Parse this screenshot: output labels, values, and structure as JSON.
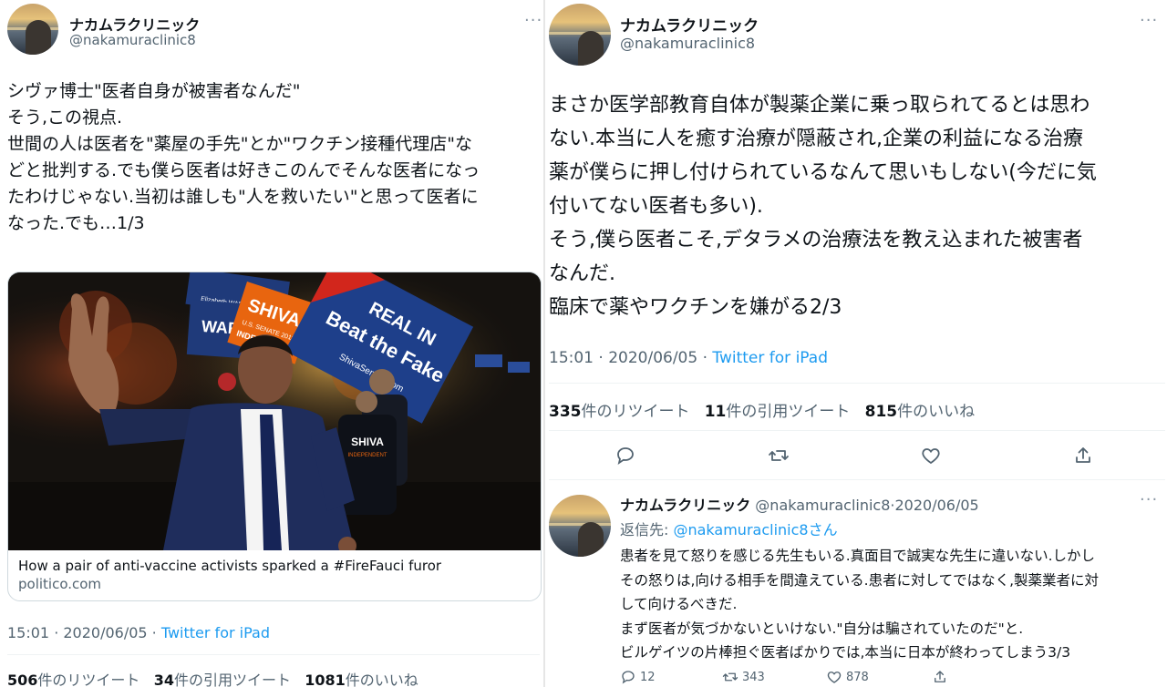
{
  "left": {
    "author": {
      "name": "ナカムラクリニック",
      "handle": "@nakamuraclinic8"
    },
    "more_label": "···",
    "text": "シヴァ博士\"医者自身が被害者なんだ\"\nそう,この視点.\n世間の人は医者を\"薬屋の手先\"とか\"ワクチン接種代理店\"な\nどと批判する.でも僕ら医者は好きこのんでそんな医者になっ\nたわけじゃない.当初は誰しも\"人を救いたい\"と思って医者に\nなった.でも…1/3",
    "card": {
      "title": "How a pair of anti-vaccine activists sparked a #FireFauci furor",
      "domain": "politico.com",
      "signs": [
        "SHIVA",
        "U.S. SENATE 2018",
        "INDEPENDENT",
        "Elizabeth WARREN FOR",
        "SHIVA",
        "INDEPENDENT",
        "REAL IN",
        "Beat the Fake",
        "ShivaSenate.com"
      ]
    },
    "time": "15:01 · 2020/06/05 · ",
    "source": "Twitter for iPad",
    "stats": {
      "retweets": "506",
      "retweets_label": "件のリツイート",
      "quotes": "34",
      "quotes_label": "件の引用ツイート",
      "likes": "1081",
      "likes_label": "件のいいね"
    }
  },
  "right": {
    "author": {
      "name": "ナカムラクリニック",
      "handle": "@nakamuraclinic8"
    },
    "more_label": "···",
    "text": "まさか医学部教育自体が製薬企業に乗っ取られてるとは思わ\nない.本当に人を癒す治療が隠蔽され,企業の利益になる治療\n薬が僕らに押し付けられているなんて思いもしない(今だに気\n付いてない医者も多い).\nそう,僕ら医者こそ,デタラメの治療法を教え込まれた被害者\nなんだ.\n臨床で薬やワクチンを嫌がる2/3",
    "time": "15:01 · 2020/06/05 · ",
    "source": "Twitter for iPad",
    "stats": {
      "retweets": "335",
      "retweets_label": "件のリツイート",
      "quotes": "11",
      "quotes_label": "件の引用ツイート",
      "likes": "815",
      "likes_label": "件のいいね"
    },
    "actions": [
      "reply-icon",
      "retweet-icon",
      "like-icon",
      "share-icon"
    ],
    "reply": {
      "name": "ナカムラクリニック",
      "handle_date": "@nakamuraclinic8·2020/06/05",
      "more_label": "···",
      "reply_to_prefix": "返信先: ",
      "reply_to_handle": "@nakamuraclinic8さん",
      "text": "患者を見て怒りを感じる先生もいる.真面目で誠実な先生に違いない.しかし\nその怒りは,向ける相手を間違えている.患者に対してではなく,製薬業者に対\nして向けるべきだ.\nまず医者が気づかないといけない.\"自分は騙されていたのだ\"と.\nビルゲイツの片棒担ぐ医者ばかりでは,本当に日本が終わってしまう3/3",
      "counts": {
        "replies": "12",
        "retweets": "343",
        "likes": "878"
      }
    }
  },
  "colors": {
    "link": "#1d9bf0",
    "muted": "#536471",
    "text": "#0f1419",
    "border": "#cfd9de"
  }
}
